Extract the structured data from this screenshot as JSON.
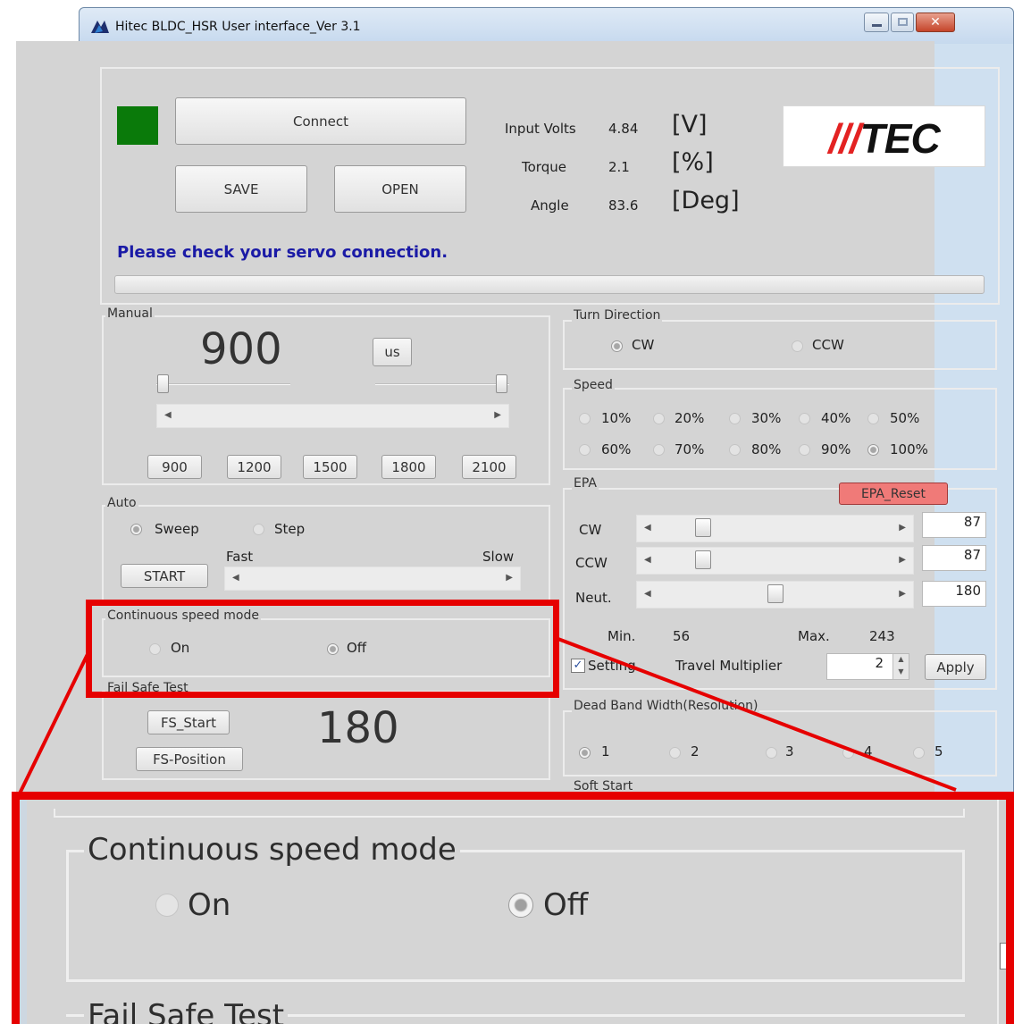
{
  "window": {
    "title": "Hitec BLDC_HSR User interface_Ver 3.1"
  },
  "top": {
    "connect_label": "Connect",
    "save_label": "SAVE",
    "open_label": "OPEN",
    "input_volts_label": "Input Volts",
    "input_volts_value": "4.84",
    "input_volts_unit": "[V]",
    "torque_label": "Torque",
    "torque_value": "2.1",
    "torque_unit": "[%]",
    "angle_label": "Angle",
    "angle_value": "83.6",
    "angle_unit": "[Deg]",
    "logo_text": "HITEC",
    "status_message": "Please check your servo connection.",
    "status_color": "#1a1aa6",
    "connection_led_color": "#0a7a0a"
  },
  "manual": {
    "legend": "Manual",
    "value": "900",
    "unit_button": "us",
    "presets": [
      "900",
      "1200",
      "1500",
      "1800",
      "2100"
    ]
  },
  "auto": {
    "legend": "Auto",
    "sweep_label": "Sweep",
    "step_label": "Step",
    "selected": "Sweep",
    "start_label": "START",
    "fast_label": "Fast",
    "slow_label": "Slow"
  },
  "continuous": {
    "legend": "Continuous speed mode",
    "on_label": "On",
    "off_label": "Off",
    "selected": "Off"
  },
  "failsafe": {
    "legend": "Fail Safe Test",
    "start_label": "FS_Start",
    "position_label": "FS-Position",
    "value": "180"
  },
  "turn_direction": {
    "legend": "Turn Direction",
    "cw_label": "CW",
    "ccw_label": "CCW",
    "selected": "CW"
  },
  "speed": {
    "legend": "Speed",
    "options": [
      "10%",
      "20%",
      "30%",
      "40%",
      "50%",
      "60%",
      "70%",
      "80%",
      "90%",
      "100%"
    ],
    "selected": "100%"
  },
  "epa": {
    "legend": "EPA",
    "reset_label": "EPA_Reset",
    "reset_color": "#f07a78",
    "rows": [
      {
        "label": "CW",
        "value": "87"
      },
      {
        "label": "CCW",
        "value": "87"
      },
      {
        "label": "Neut.",
        "value": "180"
      }
    ],
    "min_label": "Min.",
    "min_value": "56",
    "max_label": "Max.",
    "max_value": "243",
    "setting_label": "Setting",
    "setting_checked": true,
    "travel_label": "Travel Multiplier",
    "travel_value": "2",
    "apply_label": "Apply"
  },
  "deadband": {
    "legend": "Dead Band Width(Resolution)",
    "options": [
      "1",
      "2",
      "3",
      "4",
      "5"
    ],
    "selected": "1"
  },
  "softstart": {
    "legend": "Soft Start"
  },
  "zoom": {
    "continuous_legend": "Continuous speed mode",
    "on_label": "On",
    "off_label": "Off",
    "failsafe_legend": "Fail Safe Test",
    "highlight_color": "#e60000"
  }
}
